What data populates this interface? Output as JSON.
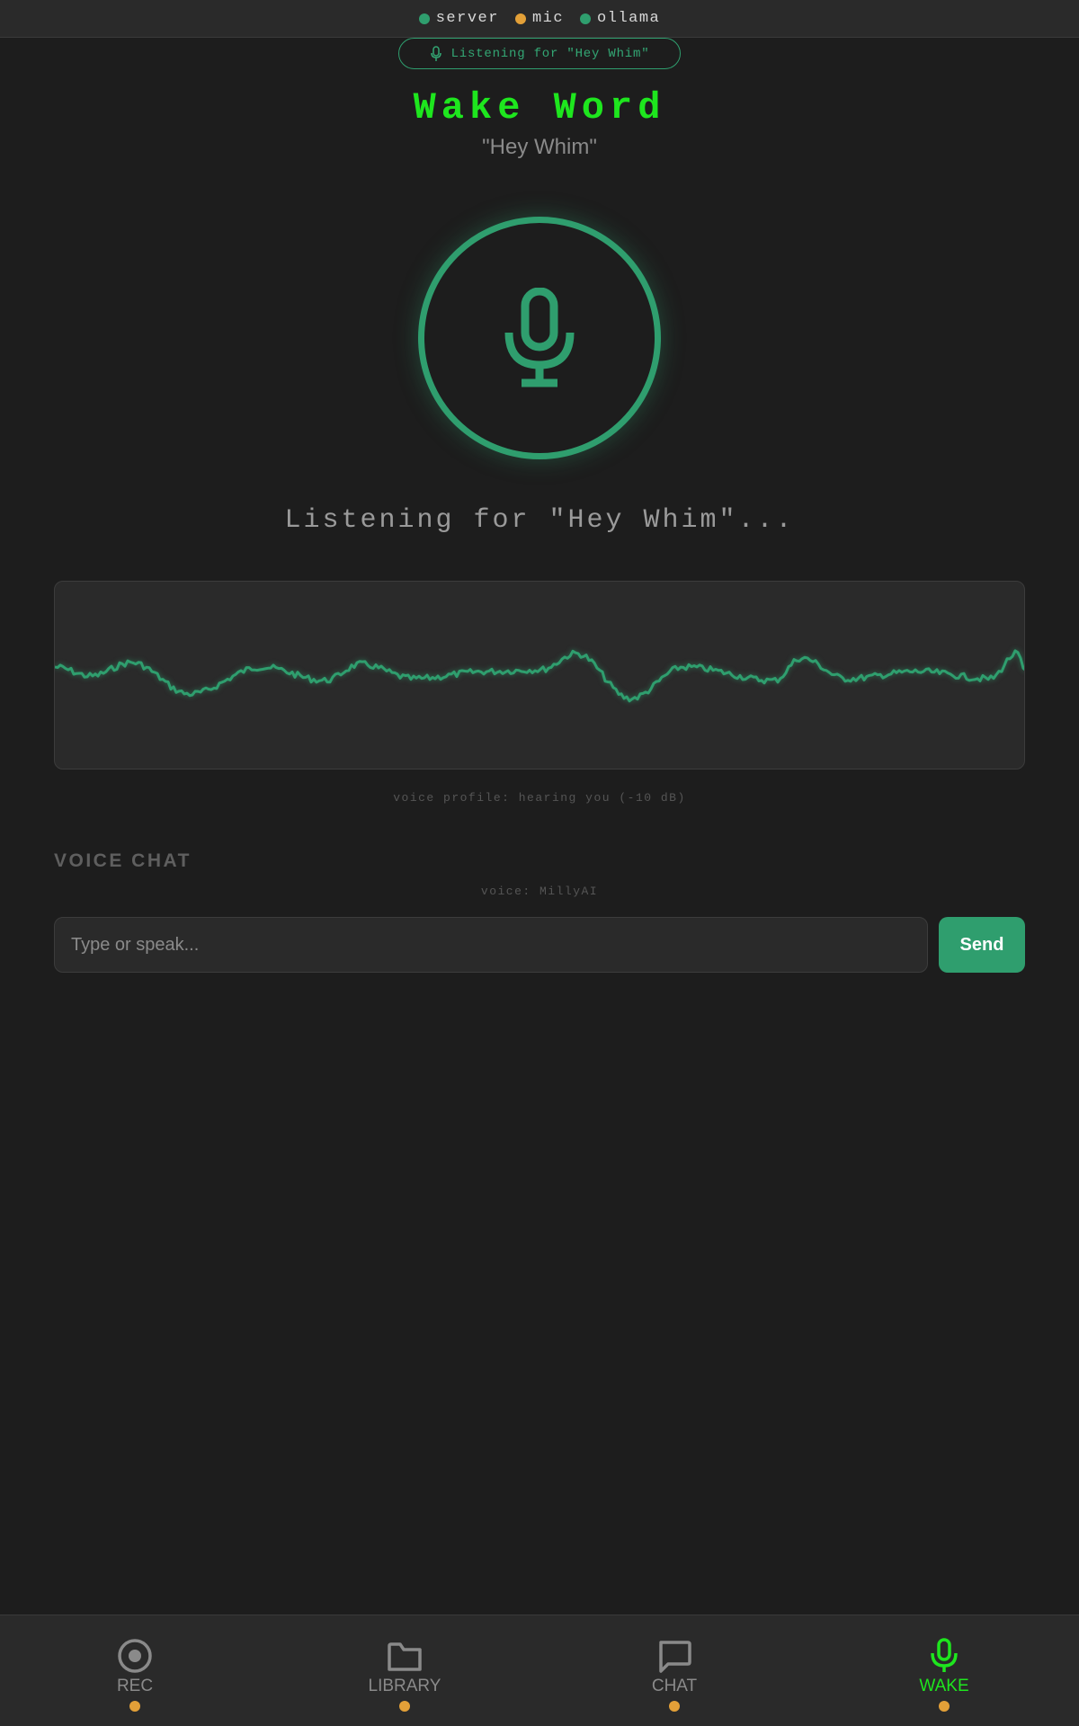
{
  "status_bar": {
    "items": [
      {
        "label": "server",
        "color": "#2f9e6e"
      },
      {
        "label": "mic",
        "color": "#e3a038"
      },
      {
        "label": "ollama",
        "color": "#2f9e6e"
      }
    ]
  },
  "pill": {
    "label": "Listening for \"Hey Whim\"",
    "icon": "mic-icon"
  },
  "header": {
    "title": "Wake Word",
    "subtitle": "\"Hey Whim\""
  },
  "mic_button": {
    "icon": "mic-icon"
  },
  "listening_status": "Listening for \"Hey Whim\"...",
  "voice_profile": "voice profile: hearing you (-10 dB)",
  "voice_chat": {
    "heading": "VOICE CHAT",
    "voice_label": "voice: MillyAI",
    "input_placeholder": "Type or speak...",
    "input_value": "",
    "send_label": "Send"
  },
  "bottom_nav": {
    "items": [
      {
        "label": "REC",
        "icon": "record-icon",
        "active": false
      },
      {
        "label": "LIBRARY",
        "icon": "folder-icon",
        "active": false
      },
      {
        "label": "CHAT",
        "icon": "chat-bubble-icon",
        "active": false
      },
      {
        "label": "WAKE",
        "icon": "mic-icon",
        "active": true
      }
    ],
    "indicator_color": "#e3a038"
  },
  "colors": {
    "accent_green": "#2f9e6e",
    "bright_green": "#1ee61e",
    "warning_orange": "#e3a038",
    "background": "#1d1d1d",
    "panel": "#2a2a2a"
  }
}
